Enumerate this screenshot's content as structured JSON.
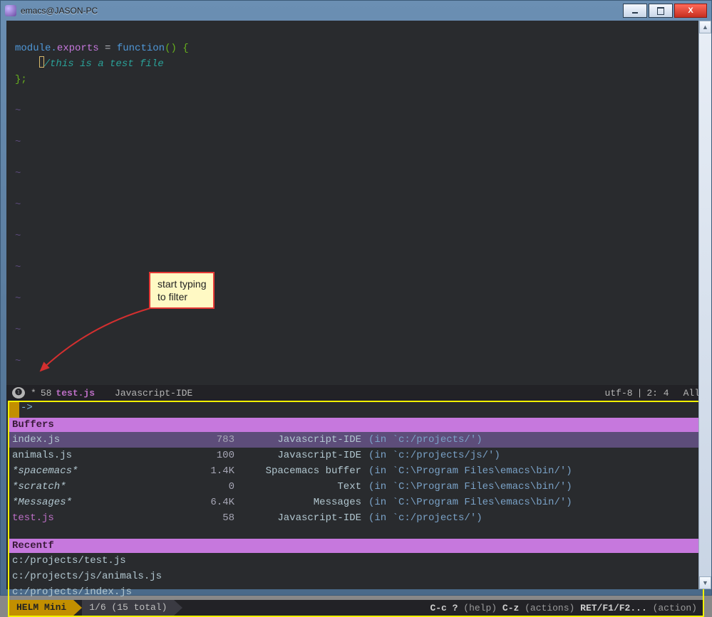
{
  "window": {
    "title": "emacs@JASON-PC"
  },
  "colors": {
    "accent": "#c678dd",
    "helm_gutter": "#c28f00",
    "border": "#f2f200"
  },
  "code": {
    "line1": {
      "module": "module.",
      "exports": "exports",
      "eq": " = ",
      "func": "function",
      "parens": "() ",
      "brace": "{"
    },
    "line2_comment": "/this is a test file",
    "line3": "};"
  },
  "modeline": {
    "bullet": "❶",
    "modified": "*",
    "size": "58",
    "filename": "test.js",
    "major_mode": "Javascript-IDE",
    "encoding": "utf-8",
    "position": "2: 4",
    "scroll": "All"
  },
  "helm": {
    "prompt": "->",
    "sections": {
      "buffers_header": "Buffers",
      "recentf_header": "Recentf"
    },
    "buffers": [
      {
        "name": "index.js",
        "size": "783",
        "mode": "Javascript-IDE",
        "loc": "(in `c:/projects/')",
        "selected": true
      },
      {
        "name": "animals.js",
        "size": "100",
        "mode": "Javascript-IDE",
        "loc": "(in `c:/projects/js/')"
      },
      {
        "name": "*spacemacs*",
        "size": "1.4K",
        "mode": "Spacemacs buffer",
        "loc": "(in `C:\\Program Files\\emacs\\bin/')",
        "special": true
      },
      {
        "name": "*scratch*",
        "size": "0",
        "mode": "Text",
        "loc": "(in `C:\\Program Files\\emacs\\bin/')",
        "special": true
      },
      {
        "name": "*Messages*",
        "size": "6.4K",
        "mode": "Messages",
        "loc": "(in `C:\\Program Files\\emacs\\bin/')",
        "special": true
      },
      {
        "name": "test.js",
        "size": "58",
        "mode": "Javascript-IDE",
        "loc": "(in `c:/projects/')",
        "current": true
      }
    ],
    "recentf": [
      "c:/projects/test.js",
      "c:/projects/js/animals.js",
      "c:/projects/index.js"
    ],
    "statusbar": {
      "label": "HELM Mini",
      "count": "1/6 (15 total)",
      "help_key": "C-c ?",
      "help_txt": "(help)",
      "act_key": "C-z",
      "act_txt": "(actions)",
      "ret_key": "RET/F1/F2...",
      "ret_txt": "(action)"
    }
  },
  "callout": {
    "line1": "start typing",
    "line2": "to filter"
  }
}
